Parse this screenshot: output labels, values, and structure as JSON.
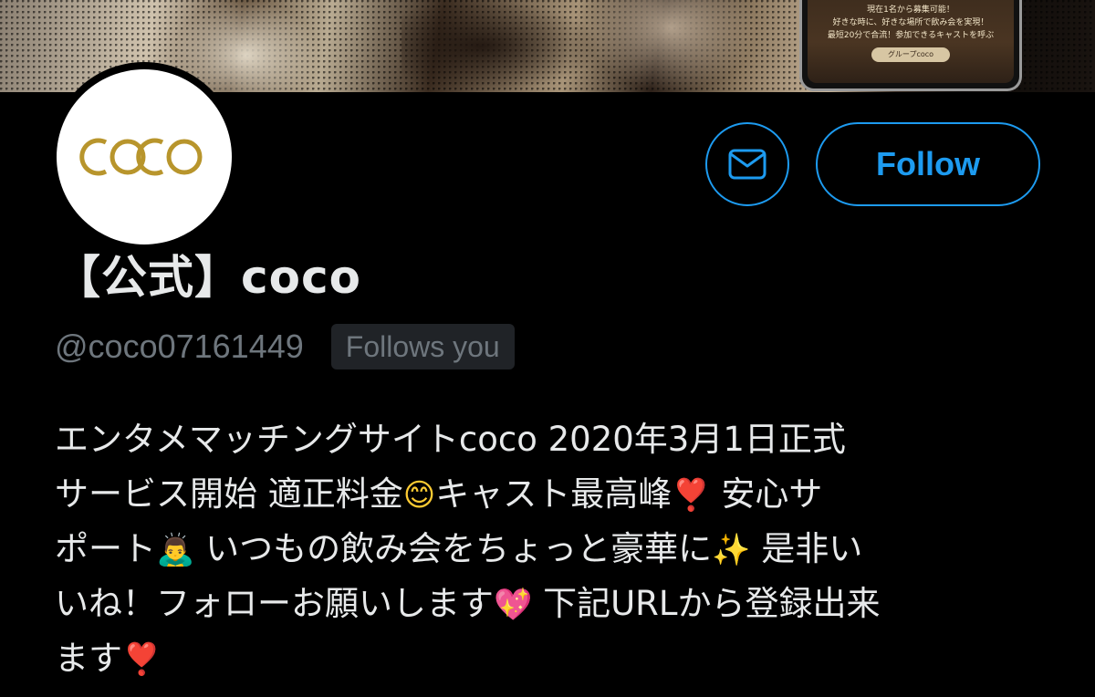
{
  "banner": {
    "promo_lines": [
      "現在1名から募集可能！",
      "好きな時に、好きな場所で飲み会を実現！",
      "最短20分で合流！参加できるキャストを呼ぶ"
    ],
    "promo_button": "グループcoco"
  },
  "avatar": {
    "logo_text": "coco"
  },
  "actions": {
    "message_icon": "envelope-icon",
    "follow_label": "Follow",
    "accent_color": "#1d9bf0"
  },
  "profile": {
    "display_name": "【公式】coco",
    "handle": "@coco07161449",
    "follows_you": "Follows you"
  },
  "bio": {
    "line1": "エンタメマッチングサイトcoco 2020年3月1日正式",
    "line2_a": "サービス開始 適正料金",
    "line2_emoji1": "😊",
    "line2_b": "キャスト最高峰",
    "line2_emoji2": "❣️",
    "line2_c": " 安心サ",
    "line3_a": "ポート",
    "line3_emoji1": "🙇‍♂️",
    "line3_b": " いつもの飲み会をちょっと豪華に",
    "line3_emoji2": "✨",
    "line3_c": " 是非い",
    "line4_a": "いね！フォローお願いします",
    "line4_emoji": "💖",
    "line4_b": " 下記URLから登録出来",
    "line5_a": "ます",
    "line5_emoji": "❣️"
  }
}
